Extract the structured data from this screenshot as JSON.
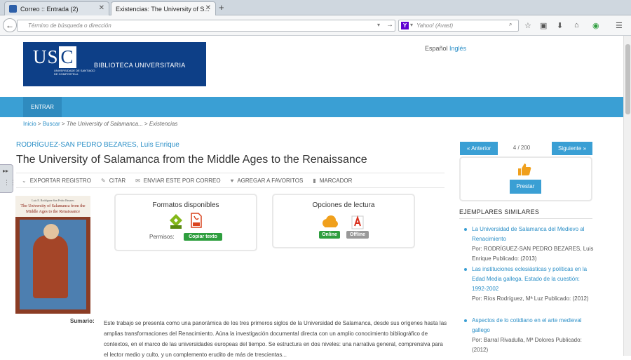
{
  "browser": {
    "tabs": [
      {
        "label": "Correo :: Entrada (2)",
        "active": false
      },
      {
        "label": "Existencias: The University of S...",
        "active": true
      }
    ],
    "url_placeholder": "Término de búsqueda o dirección",
    "search_placeholder": "Yahoo! (Avast)"
  },
  "header": {
    "logo_text": "USC",
    "logo_sub": "UNIVERSIDADE DE SANTIAGO DE COMPOSTELA",
    "library": "BIBLIOTECA UNIVERSITARIA",
    "lang_current": "Español",
    "lang_other": "Inglés"
  },
  "nav": {
    "entrar": "ENTRAR"
  },
  "breadcrumb": {
    "inicio": "Inicio",
    "sep1": " > ",
    "buscar": "Buscar",
    "sep2": " > ",
    "item": "The University of Salamanca...",
    "sep3": " > ",
    "current": "Existencias"
  },
  "record": {
    "author": "RODRÍGUEZ-SAN PEDRO BEZARES, Luis Enrique",
    "title": "The University of Salamanca from the Middle Ages to the Renaissance",
    "actions": [
      "EXPORTAR REGISTRO",
      "CITAR",
      "ENVIAR ESTE POR CORREO",
      "AGREGAR A FAVORITOS",
      "MARCADOR"
    ],
    "cover_title": "The University of Salamanca from the Middle Ages to the Renaissance",
    "cover_author": "Luis E. Rodríguez-San Pedro Bezares",
    "formatos_title": "Formatos disponibles",
    "permisos_label": "Permisos:",
    "copiar_label": "Copiar texto",
    "opciones_title": "Opciones de lectura",
    "online_label": "Online",
    "offline_label": "Offline",
    "sumario_label": "Sumario:",
    "sumario_text": "Este trabajo se presenta como una panorámica de los tres primeros siglos de la Universidad de Salamanca, desde sus orígenes hasta las amplias transformaciones del Renacimiento. Aúna la investigación documental directa con un amplio conocimiento bibliográfico de contextos, en el marco de las universidades europeas del tiempo. Se estructura en dos niveles: una narrativa general, comprensiva para el lector medio y culto, y un complemento erudito de más de trescientas..."
  },
  "sidebar": {
    "prev": "« Anterior",
    "counter": "4 / 200",
    "next": "Siguiente »",
    "prestar": "Prestar",
    "similares_title": "EJEMPLARES SIMILARES",
    "similares": [
      {
        "title": "La Universidad de Salamanca del Medievo al Renacimiento",
        "meta": "Por: RODRÍGUEZ-SAN PEDRO BEZARES, Luis Enrique Publicado: (2013)"
      },
      {
        "title": "Las instituciones eclesiásticas y políticas en la Edad Media gallega. Estado de la cuestión: 1992-2002",
        "meta": "Por: Ríos Rodríguez, Mª Luz Publicado: (2012)"
      },
      {
        "title": "Aspectos de lo cotidiano en el arte medieval gallego",
        "meta": "Por: Barral Rivadulla, Mª Dolores Publicado: (2012)"
      }
    ]
  },
  "colors": {
    "brand_blue": "#0d3f87",
    "accent": "#3a9fd4",
    "link": "#2b8fc7",
    "green": "#2e9e3e"
  }
}
